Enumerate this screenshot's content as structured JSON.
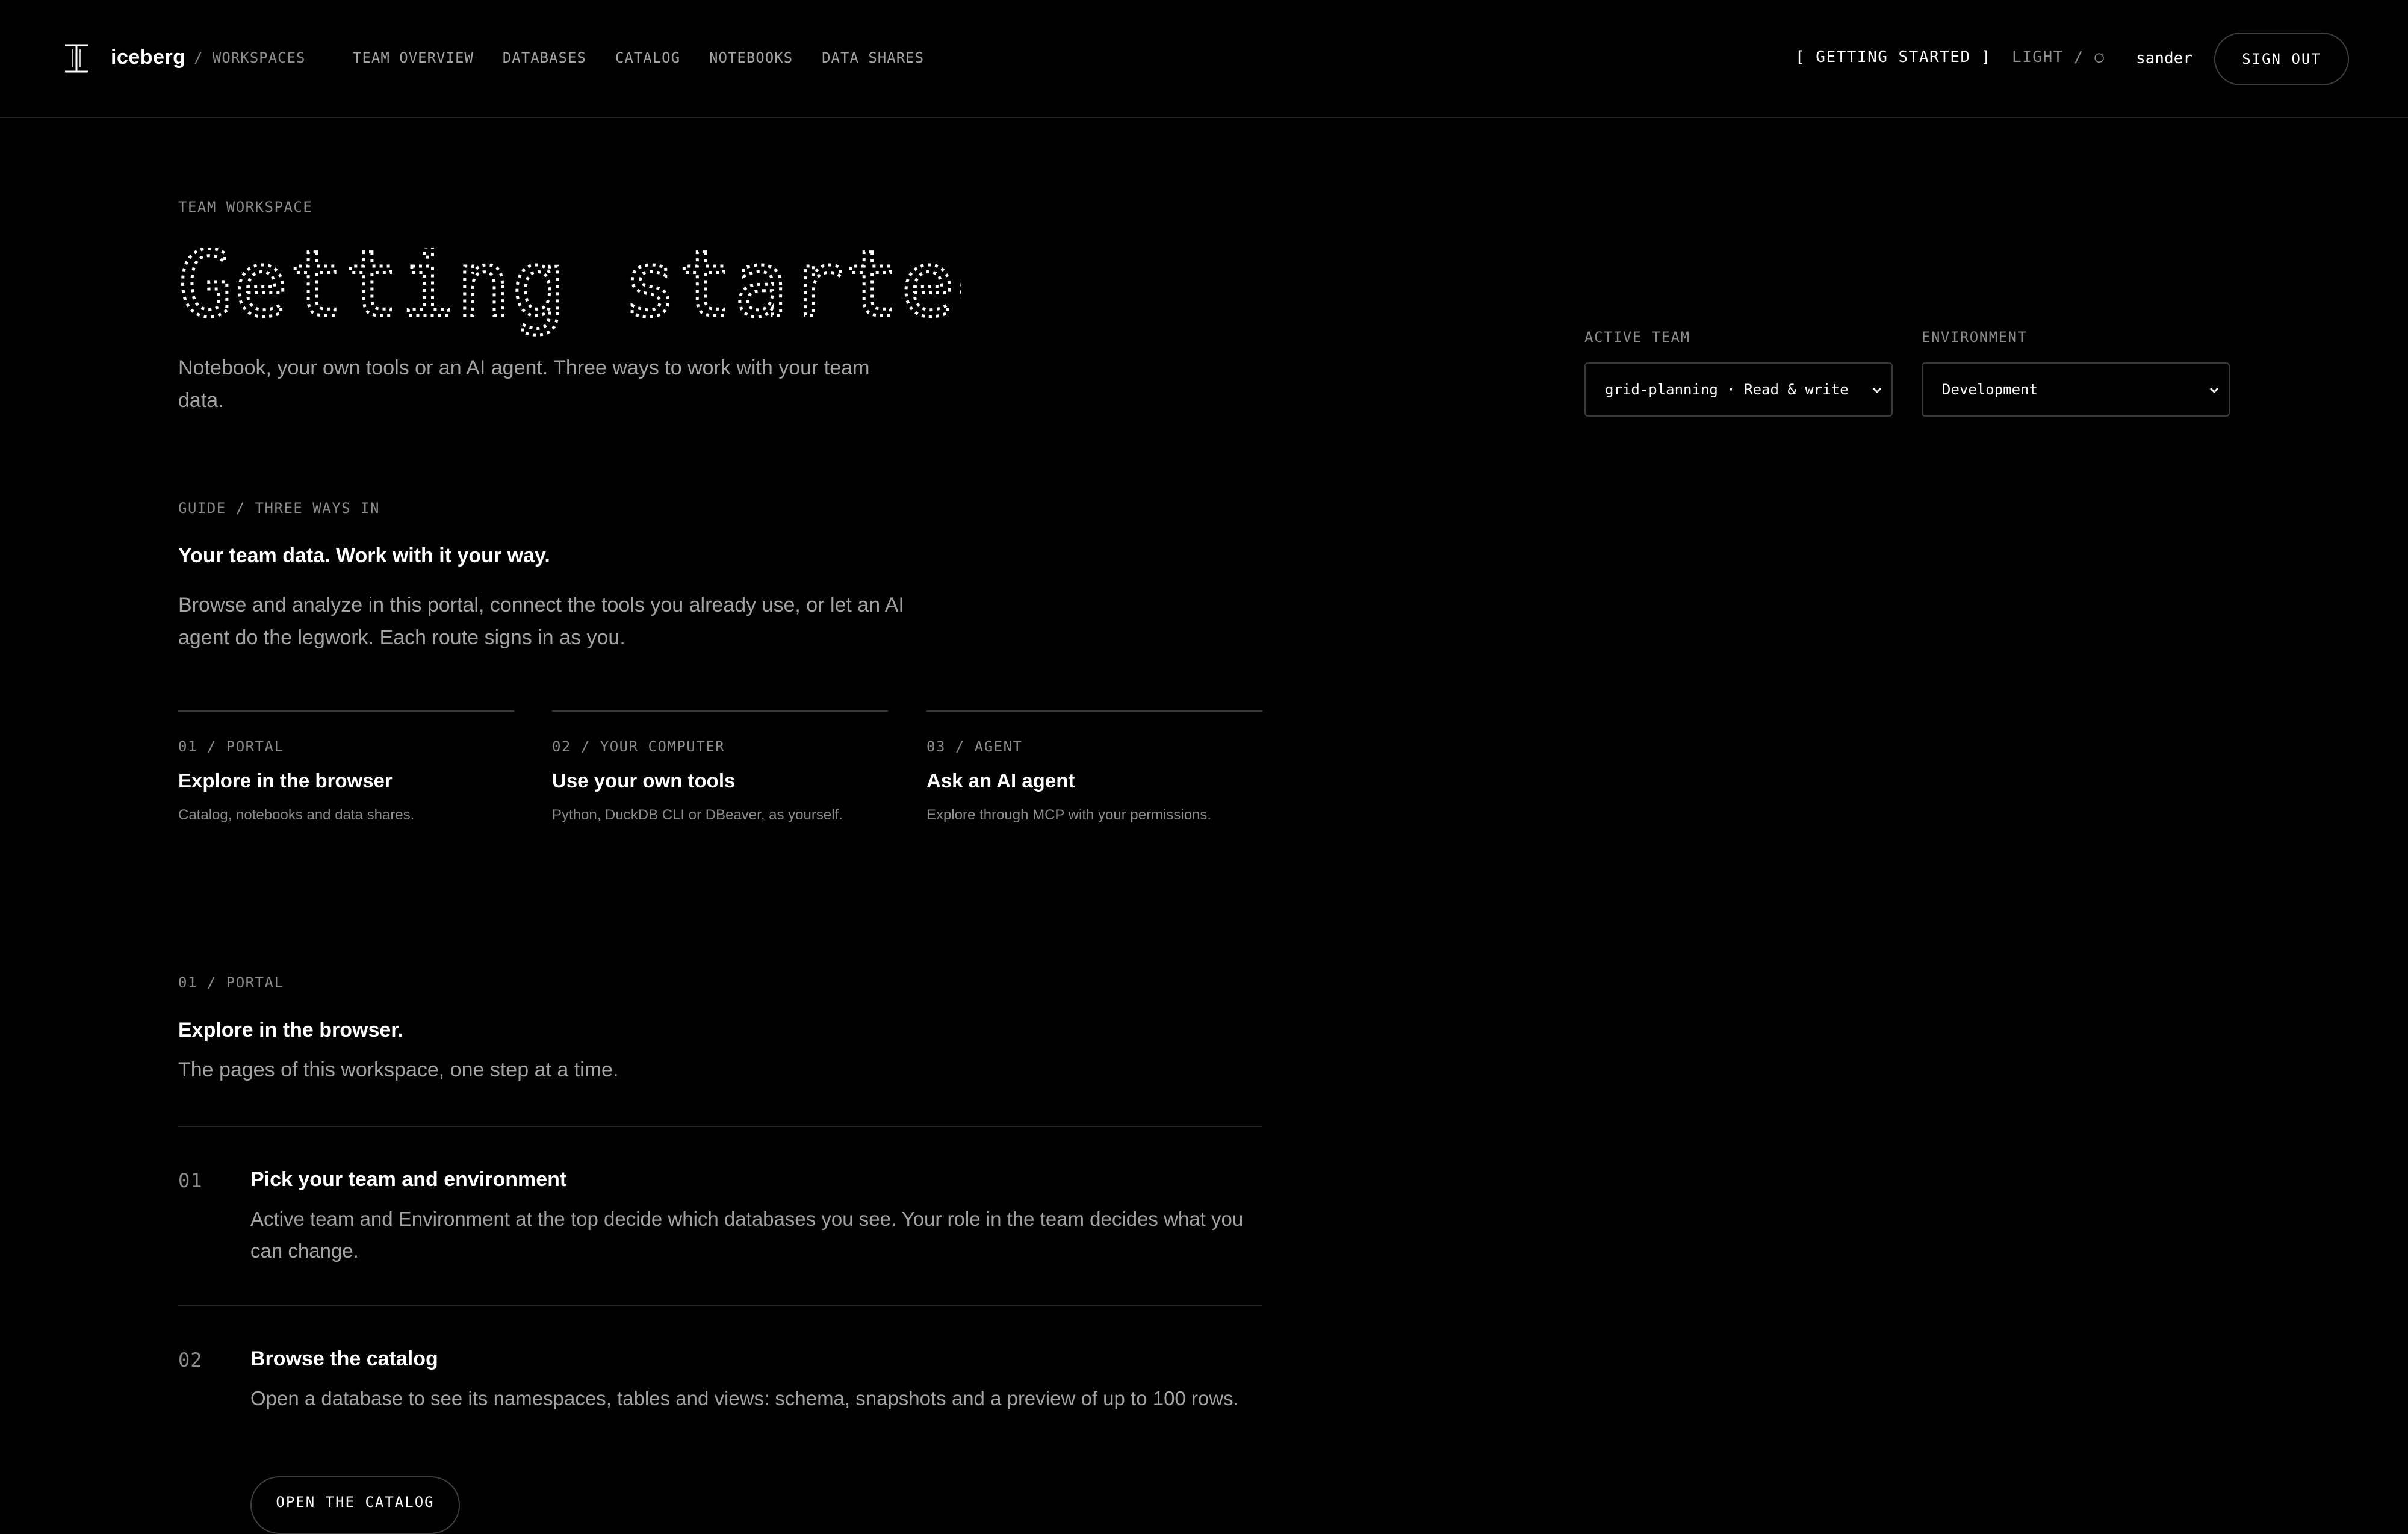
{
  "header": {
    "brand": "iceberg",
    "breadcrumb": "/ WORKSPACES",
    "nav": [
      "TEAM OVERVIEW",
      "DATABASES",
      "CATALOG",
      "NOTEBOOKS",
      "DATA SHARES"
    ],
    "getting_started": "[ GETTING STARTED ]",
    "theme_toggle": "LIGHT / ○",
    "user": "sander",
    "sign_out": "SIGN OUT"
  },
  "hero": {
    "eyebrow": "TEAM WORKSPACE",
    "title": "Getting started.",
    "lead": "Notebook, your own tools or an AI agent. Three ways to work with your team data."
  },
  "selectors": {
    "team_label": "ACTIVE TEAM",
    "team_value": "grid-planning · Read & write",
    "env_label": "ENVIRONMENT",
    "env_value": "Development"
  },
  "guide": {
    "eyebrow": "GUIDE / THREE WAYS IN",
    "heading": "Your team data. Work with it your way.",
    "lead": "Browse and analyze in this portal, connect the tools you already use, or let an AI agent do the legwork. Each route signs in as you.",
    "cards": [
      {
        "eyebrow": "01 / PORTAL",
        "title": "Explore in the browser",
        "desc": "Catalog, notebooks and data shares."
      },
      {
        "eyebrow": "02 / YOUR COMPUTER",
        "title": "Use your own tools",
        "desc": "Python, DuckDB CLI or DBeaver, as yourself."
      },
      {
        "eyebrow": "03 / AGENT",
        "title": "Ask an AI agent",
        "desc": "Explore through MCP with your permissions."
      }
    ]
  },
  "portal": {
    "eyebrow": "01 / PORTAL",
    "heading": "Explore in the browser.",
    "lead": "The pages of this workspace, one step at a time.",
    "steps": [
      {
        "num": "01",
        "title": "Pick your team and environment",
        "desc": "Active team and Environment at the top decide which databases you see. Your role in the team decides what you can change."
      },
      {
        "num": "02",
        "title": "Browse the catalog",
        "desc": "Open a database to see its namespaces, tables and views: schema, snapshots and a preview of up to 100 rows.",
        "button": "OPEN THE CATALOG"
      }
    ]
  },
  "icons": {
    "logo": "iceberg-logo-icon",
    "select_arrow": "chevron-down-icon"
  },
  "colors": {
    "background": "#000000",
    "text": "#ffffff",
    "muted": "#8c8c8c",
    "border": "#3a3a3a"
  }
}
